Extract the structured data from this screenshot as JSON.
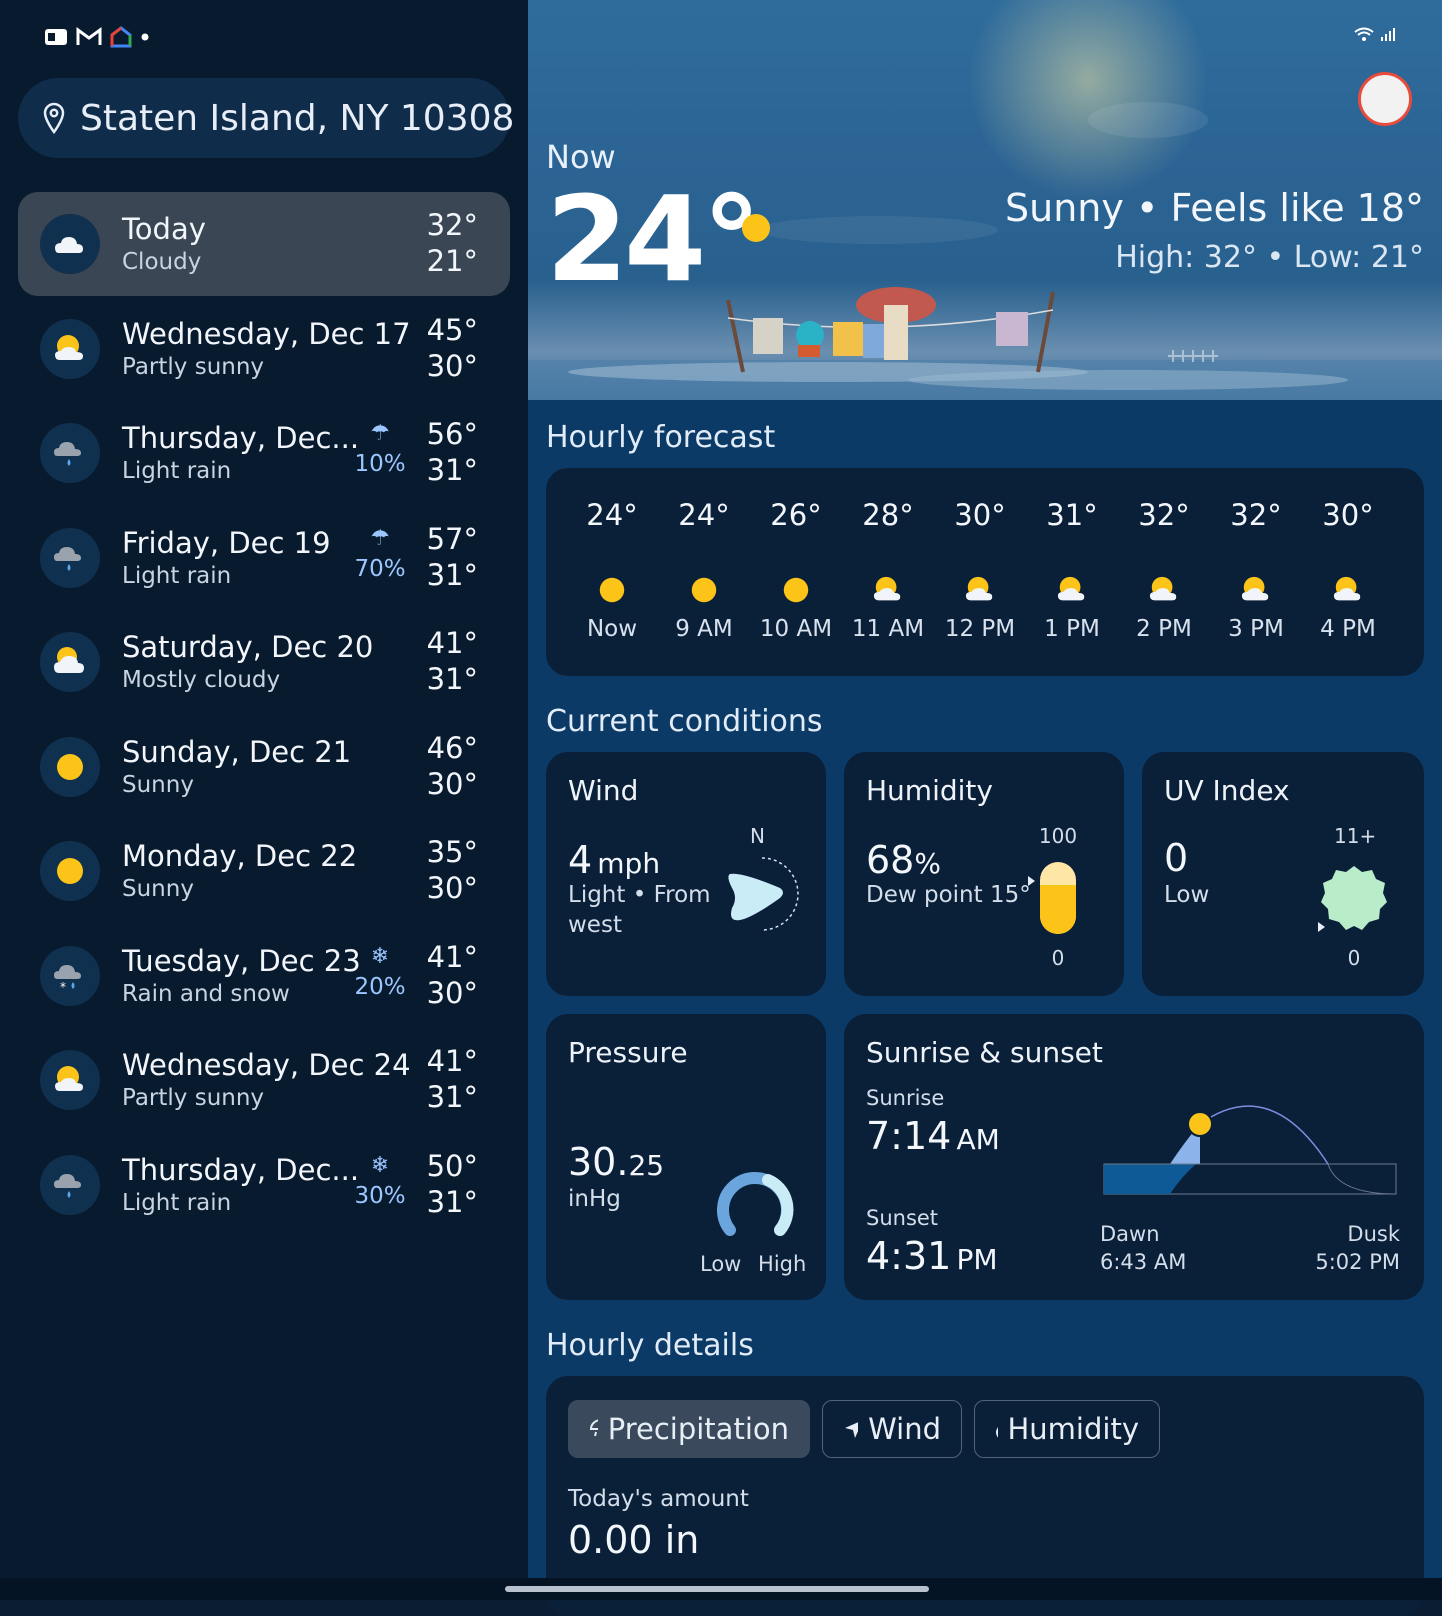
{
  "status": {
    "left_icons": [
      "news-icon",
      "gmail-icon",
      "home-icon",
      "dot-icon"
    ],
    "right_icons": [
      "wifi-icon",
      "signal-icon"
    ]
  },
  "location": {
    "label": "Staten Island, NY 10308"
  },
  "daily": [
    {
      "name": "Today",
      "cond": "Cloudy",
      "hi": "32°",
      "lo": "21°",
      "icon": "cloudy-icon",
      "precip_icon": "",
      "precip": ""
    },
    {
      "name": "Wednesday, Dec 17",
      "cond": "Partly sunny",
      "hi": "45°",
      "lo": "30°",
      "icon": "partly-sunny-icon",
      "precip_icon": "",
      "precip": ""
    },
    {
      "name": "Thursday, Dec...",
      "cond": "Light rain",
      "hi": "56°",
      "lo": "31°",
      "icon": "rain-icon",
      "precip_icon": "☂",
      "precip": "10%"
    },
    {
      "name": "Friday, Dec 19",
      "cond": "Light rain",
      "hi": "57°",
      "lo": "31°",
      "icon": "rain-icon",
      "precip_icon": "☂",
      "precip": "70%"
    },
    {
      "name": "Saturday, Dec 20",
      "cond": "Mostly cloudy",
      "hi": "41°",
      "lo": "31°",
      "icon": "mostly-cloudy-icon",
      "precip_icon": "",
      "precip": ""
    },
    {
      "name": "Sunday, Dec 21",
      "cond": "Sunny",
      "hi": "46°",
      "lo": "30°",
      "icon": "sunny-icon",
      "precip_icon": "",
      "precip": ""
    },
    {
      "name": "Monday, Dec 22",
      "cond": "Sunny",
      "hi": "35°",
      "lo": "30°",
      "icon": "sunny-icon",
      "precip_icon": "",
      "precip": ""
    },
    {
      "name": "Tuesday, Dec 23",
      "cond": "Rain and snow",
      "hi": "41°",
      "lo": "30°",
      "icon": "rain-snow-icon",
      "precip_icon": "❄",
      "precip": "20%"
    },
    {
      "name": "Wednesday, Dec 24",
      "cond": "Partly sunny",
      "hi": "41°",
      "lo": "31°",
      "icon": "partly-sunny-icon",
      "precip_icon": "",
      "precip": ""
    },
    {
      "name": "Thursday, Dec...",
      "cond": "Light rain",
      "hi": "50°",
      "lo": "31°",
      "icon": "rain-icon",
      "precip_icon": "❄",
      "precip": "30%"
    }
  ],
  "now": {
    "label": "Now",
    "temp": "24°",
    "condition": "Sunny • Feels like 18°",
    "high_low": "High: 32° • Low: 21°"
  },
  "hourly": {
    "title": "Hourly forecast",
    "items": [
      {
        "temp": "24°",
        "label": "Now",
        "icon": "sunny-icon"
      },
      {
        "temp": "24°",
        "label": "9 AM",
        "icon": "sunny-icon"
      },
      {
        "temp": "26°",
        "label": "10 AM",
        "icon": "sunny-icon"
      },
      {
        "temp": "28°",
        "label": "11 AM",
        "icon": "partly-sunny-icon"
      },
      {
        "temp": "30°",
        "label": "12 PM",
        "icon": "partly-sunny-icon"
      },
      {
        "temp": "31°",
        "label": "1 PM",
        "icon": "partly-sunny-icon"
      },
      {
        "temp": "32°",
        "label": "2 PM",
        "icon": "partly-sunny-icon"
      },
      {
        "temp": "32°",
        "label": "3 PM",
        "icon": "partly-sunny-icon"
      },
      {
        "temp": "30°",
        "label": "4 PM",
        "icon": "partly-sunny-icon"
      }
    ]
  },
  "conditions": {
    "title": "Current conditions",
    "wind": {
      "title": "Wind",
      "value": "4",
      "unit": "mph",
      "desc1": "Light • From",
      "desc2": "west",
      "compass": "N"
    },
    "humidity": {
      "title": "Humidity",
      "value": "68",
      "unit": "%",
      "dew": "Dew point 15°",
      "max": "100",
      "min": "0",
      "level": 0.68
    },
    "uv": {
      "title": "UV Index",
      "value": "0",
      "desc": "Low",
      "max": "11+",
      "min": "0"
    },
    "pressure": {
      "title": "Pressure",
      "value_main": "30.",
      "value_dec": "25",
      "unit": "inHg",
      "low": "Low",
      "high": "High"
    },
    "sun": {
      "title": "Sunrise & sunset",
      "sunrise_label": "Sunrise",
      "sunrise_time": "7:14",
      "sunrise_ampm": "AM",
      "sunset_label": "Sunset",
      "sunset_time": "4:31",
      "sunset_ampm": "PM",
      "dawn_label": "Dawn",
      "dawn_time": "6:43 AM",
      "dusk_label": "Dusk",
      "dusk_time": "5:02 PM"
    }
  },
  "details": {
    "title": "Hourly details",
    "tabs": [
      {
        "label": "Precipitation",
        "icon": "umbrella-icon"
      },
      {
        "label": "Wind",
        "icon": "navigation-arrow-icon"
      },
      {
        "label": "Humidity",
        "icon": "droplet-icon"
      }
    ],
    "amount_label": "Today's amount",
    "amount_value": "0.00 in"
  },
  "colors": {
    "sun": "#fcc419",
    "accent": "#9cc6ff",
    "panel": "#0a1f38"
  }
}
